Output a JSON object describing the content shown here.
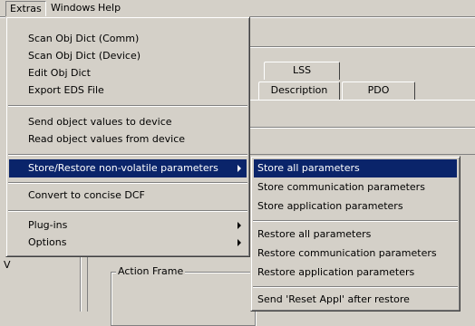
{
  "menubar": {
    "items": [
      "Extras",
      "Windows",
      "Help"
    ]
  },
  "background": {
    "tabs": [
      "LSS",
      "Description",
      "PDO"
    ],
    "frame_label": "Action Frame",
    "left_letter": "V"
  },
  "extras_menu": {
    "items": [
      "Scan Obj Dict (Comm)",
      "Scan Obj Dict (Device)",
      "Edit Obj Dict",
      "Export EDS File",
      "Send object values to device",
      "Read object values from device",
      "Store/Restore non-volatile parameters",
      "Convert to concise DCF",
      "Plug-ins",
      "Options"
    ]
  },
  "store_submenu": {
    "items": [
      "Store all parameters",
      "Store communication parameters",
      "Store application parameters",
      "Restore all parameters",
      "Restore communication parameters",
      "Restore application parameters",
      "Send 'Reset Appl' after restore"
    ]
  },
  "colors": {
    "menu_bg": "#d4d0c8",
    "highlight": "#0a246a",
    "highlight_text": "#ffffff"
  }
}
